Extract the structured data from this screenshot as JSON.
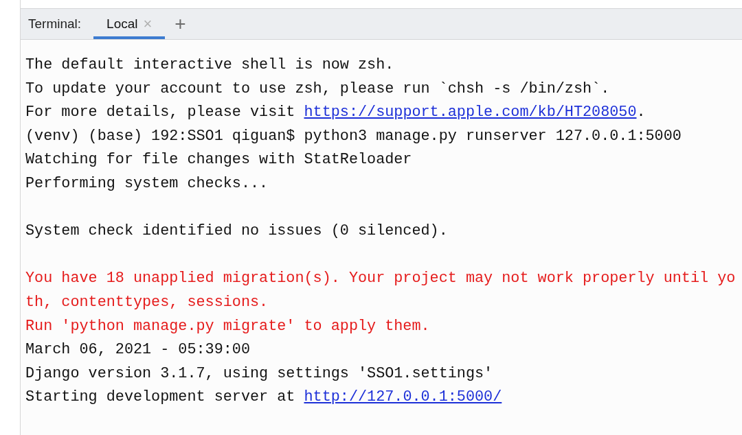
{
  "tool_window": {
    "title": "Terminal:"
  },
  "tabs": [
    {
      "label": "Local",
      "close": "×",
      "selected": true
    }
  ],
  "new_tab_button": "+",
  "terminal": {
    "blocks": [
      [
        {
          "kind": "output",
          "segments": [
            {
              "kind": "plain",
              "text": "The default interactive shell is now zsh."
            }
          ]
        },
        {
          "kind": "output",
          "segments": [
            {
              "kind": "plain",
              "text": "To update your account to use zsh, please run `chsh -s /bin/zsh`."
            }
          ]
        },
        {
          "kind": "output",
          "segments": [
            {
              "kind": "plain",
              "text": "For more details, please visit "
            },
            {
              "kind": "link",
              "text": "https://support.apple.com/kb/HT208050"
            },
            {
              "kind": "plain",
              "text": "."
            }
          ]
        },
        {
          "kind": "output",
          "segments": [
            {
              "kind": "plain",
              "text": "(venv) (base) 192:SSO1 qiguan$ python3 manage.py runserver 127.0.0.1:5000"
            }
          ]
        },
        {
          "kind": "output",
          "segments": [
            {
              "kind": "plain",
              "text": "Watching for file changes with StatReloader"
            }
          ]
        },
        {
          "kind": "output",
          "segments": [
            {
              "kind": "plain",
              "text": "Performing system checks..."
            }
          ]
        }
      ],
      [
        {
          "kind": "output",
          "segments": [
            {
              "kind": "plain",
              "text": "System check identified no issues (0 silenced)."
            }
          ]
        }
      ],
      [
        {
          "kind": "error",
          "segments": [
            {
              "kind": "plain",
              "text": "You have 18 unapplied migration(s). Your project may not work properly until yo"
            }
          ]
        },
        {
          "kind": "error",
          "segments": [
            {
              "kind": "plain",
              "text": "th, contenttypes, sessions."
            }
          ]
        },
        {
          "kind": "error",
          "segments": [
            {
              "kind": "plain",
              "text": "Run 'python manage.py migrate' to apply them."
            }
          ]
        },
        {
          "kind": "output",
          "segments": [
            {
              "kind": "plain",
              "text": "March 06, 2021 - 05:39:00"
            }
          ]
        },
        {
          "kind": "output",
          "segments": [
            {
              "kind": "plain",
              "text": "Django version 3.1.7, using settings 'SSO1.settings'"
            }
          ]
        },
        {
          "kind": "output",
          "segments": [
            {
              "kind": "plain",
              "text": "Starting development server at "
            },
            {
              "kind": "link",
              "text": "http://127.0.0.1:5000/"
            }
          ]
        }
      ]
    ]
  }
}
